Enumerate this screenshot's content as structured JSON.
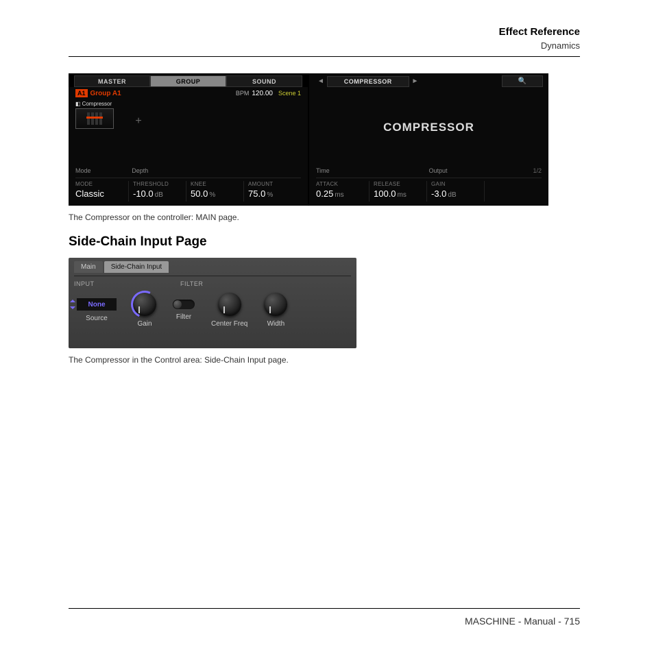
{
  "header": {
    "title": "Effect Reference",
    "subtitle": "Dynamics"
  },
  "controller": {
    "tabs": {
      "master": "MASTER",
      "group": "GROUP",
      "sound": "SOUND"
    },
    "badge": "A1",
    "group_name": "Group A1",
    "bpm_label": "BPM",
    "bpm_value": "120.00",
    "scene": "Scene 1",
    "slot_label": "Compressor",
    "sections": {
      "mode": "Mode",
      "depth": "Depth",
      "time": "Time",
      "output": "Output"
    },
    "page_indicator": "1/2",
    "nav_title": "COMPRESSOR",
    "big_title": "COMPRESSOR",
    "params": {
      "mode": {
        "label": "MODE",
        "value": "Classic",
        "unit": ""
      },
      "threshold": {
        "label": "THRESHOLD",
        "value": "-10.0",
        "unit": "dB"
      },
      "knee": {
        "label": "KNEE",
        "value": "50.0",
        "unit": "%"
      },
      "amount": {
        "label": "AMOUNT",
        "value": "75.0",
        "unit": "%"
      },
      "attack": {
        "label": "ATTACK",
        "value": "0.25",
        "unit": "ms"
      },
      "release": {
        "label": "RELEASE",
        "value": "100.0",
        "unit": "ms"
      },
      "gain": {
        "label": "GAIN",
        "value": "-3.0",
        "unit": "dB"
      }
    }
  },
  "caption1": "The Compressor on the controller: MAIN page.",
  "section_heading": "Side-Chain Input Page",
  "sidechain": {
    "tabs": {
      "main": "Main",
      "sc": "Side-Chain Input"
    },
    "sections": {
      "input": "INPUT",
      "filter": "FILTER"
    },
    "source_value": "None",
    "controls": {
      "source": "Source",
      "gain": "Gain",
      "filter": "Filter",
      "center_freq": "Center Freq",
      "width": "Width"
    }
  },
  "caption2": "The Compressor in the Control area: Side-Chain Input page.",
  "footer": "MASCHINE - Manual - 715"
}
